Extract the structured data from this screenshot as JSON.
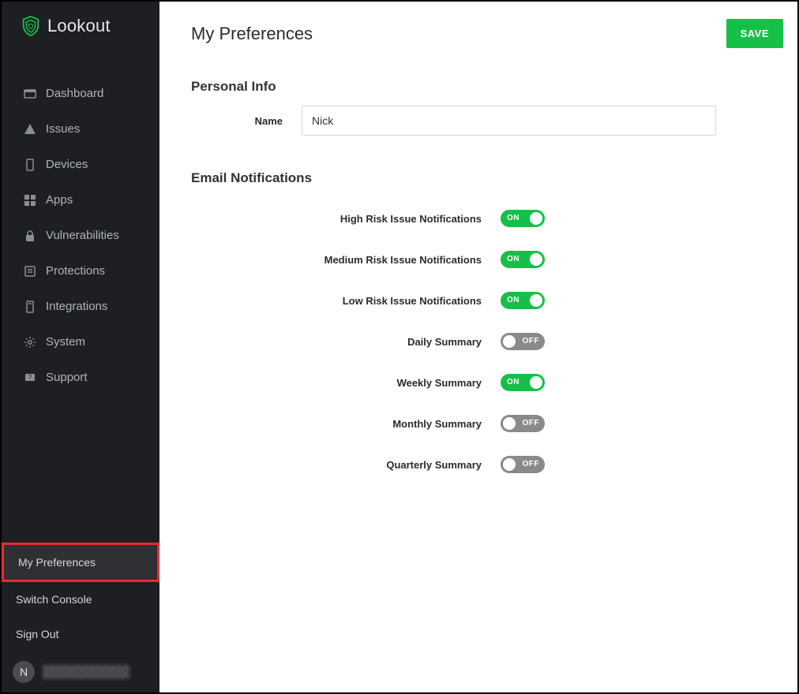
{
  "brand": {
    "name": "Lookout"
  },
  "sidebar": {
    "items": [
      {
        "label": "Dashboard"
      },
      {
        "label": "Issues"
      },
      {
        "label": "Devices"
      },
      {
        "label": "Apps"
      },
      {
        "label": "Vulnerabilities"
      },
      {
        "label": "Protections"
      },
      {
        "label": "Integrations"
      },
      {
        "label": "System"
      },
      {
        "label": "Support"
      }
    ],
    "bottom": [
      {
        "label": "My Preferences"
      },
      {
        "label": "Switch Console"
      },
      {
        "label": "Sign Out"
      }
    ]
  },
  "user": {
    "initial": "N"
  },
  "page": {
    "title": "My Preferences",
    "save": "SAVE"
  },
  "personal": {
    "section": "Personal Info",
    "nameLabel": "Name",
    "nameValue": "Nick"
  },
  "email": {
    "section": "Email Notifications",
    "toggles": [
      {
        "label": "High Risk Issue Notifications",
        "state": "on",
        "text": "ON"
      },
      {
        "label": "Medium Risk Issue Notifications",
        "state": "on",
        "text": "ON"
      },
      {
        "label": "Low Risk Issue Notifications",
        "state": "on",
        "text": "ON"
      },
      {
        "label": "Daily Summary",
        "state": "off",
        "text": "OFF"
      },
      {
        "label": "Weekly Summary",
        "state": "on",
        "text": "ON"
      },
      {
        "label": "Monthly Summary",
        "state": "off",
        "text": "OFF"
      },
      {
        "label": "Quarterly Summary",
        "state": "off",
        "text": "OFF"
      }
    ]
  }
}
